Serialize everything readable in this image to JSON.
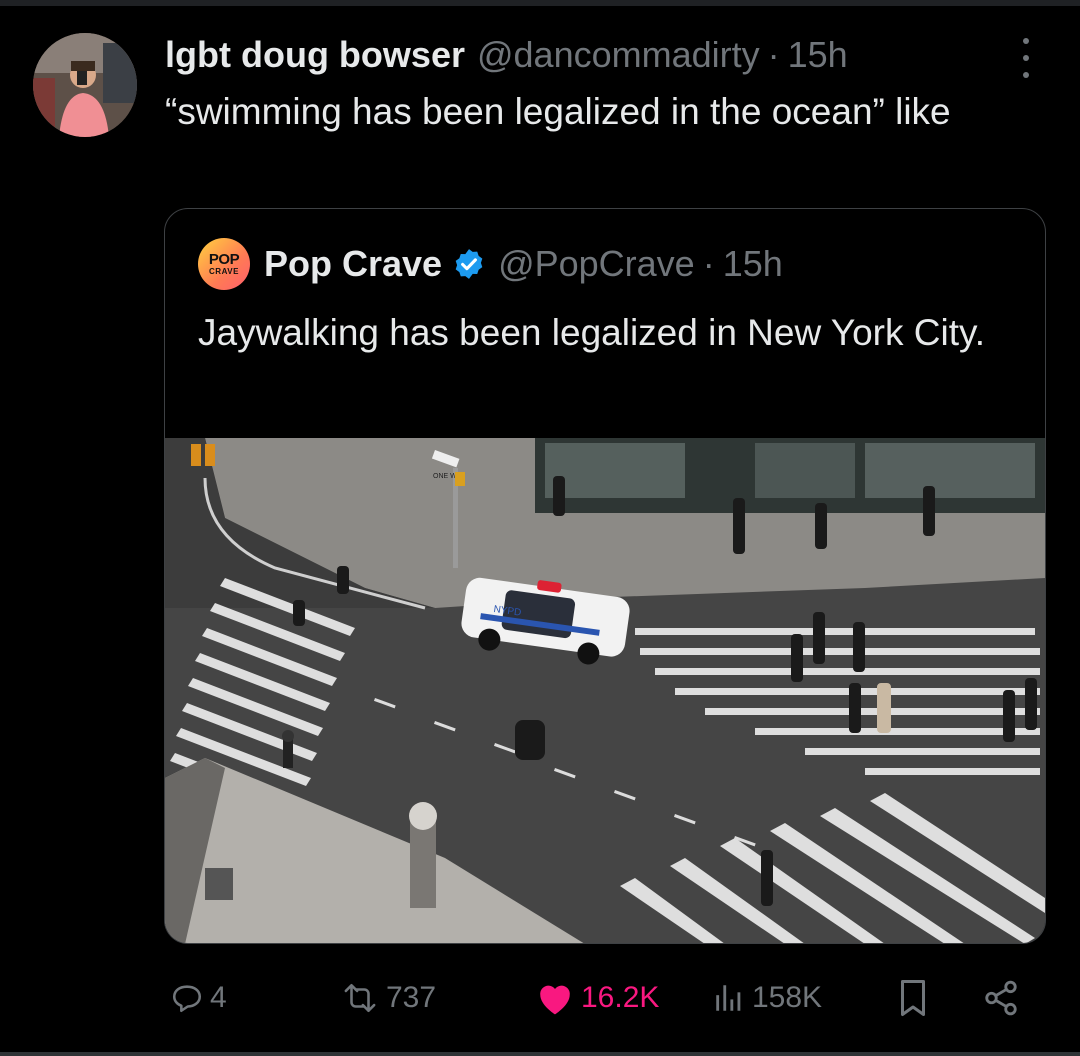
{
  "tweet": {
    "author_name": "lgbt doug bowser",
    "author_handle": "@dancommadirty",
    "separator": "·",
    "time": "15h",
    "text": "“swimming has been legalized in the ocean” like",
    "avatar_icon": "user-avatar-photo"
  },
  "quoted_tweet": {
    "author_name": "Pop Crave",
    "author_handle": "@PopCrave",
    "separator": "·",
    "time": "15h",
    "text": "Jaywalking has been legalized in New York City.",
    "avatar_text_top": "POP",
    "avatar_text_bottom": "CRAVE",
    "verified_icon": "verified-badge-icon",
    "verified_color": "#1d9bf0",
    "media": {
      "police_car_text": "NYPD",
      "sign_text": "ONE WAY"
    }
  },
  "actions": {
    "replies": "4",
    "reposts": "737",
    "likes": "16.2K",
    "views": "158K",
    "like_color": "#f91880",
    "icons": [
      "reply-icon",
      "repost-icon",
      "like-heart-icon",
      "views-icon",
      "bookmark-icon",
      "share-icon"
    ]
  },
  "colors": {
    "background": "#000000",
    "text_primary": "#e7e9ea",
    "text_secondary": "#71767b",
    "border": "#3e4144"
  }
}
